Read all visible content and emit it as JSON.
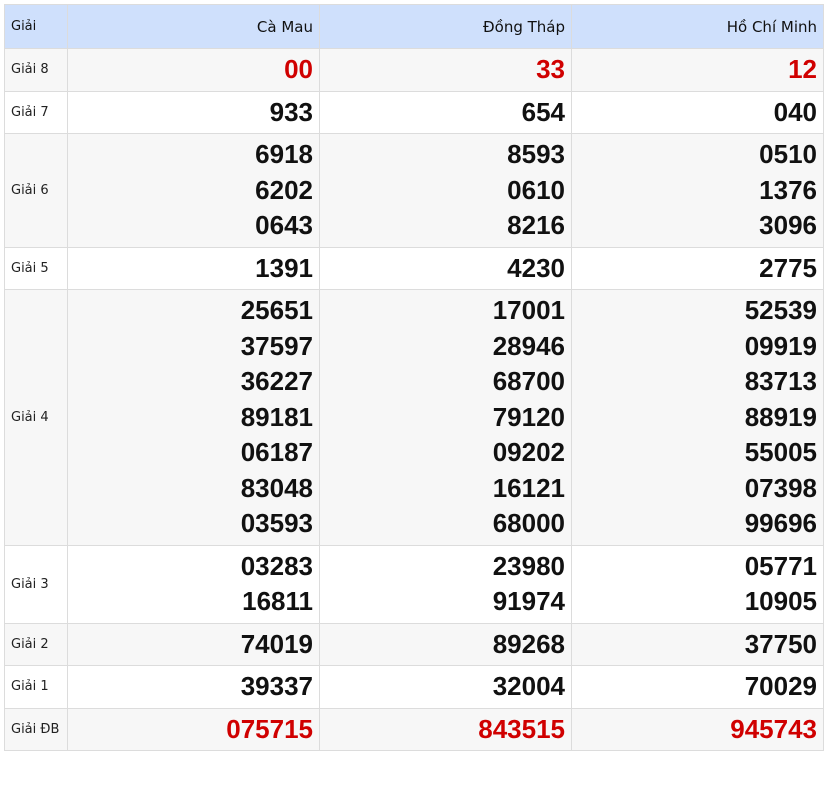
{
  "header": {
    "label": "Giải",
    "provinces": [
      "Cà Mau",
      "Đồng Tháp",
      "Hồ Chí Minh"
    ]
  },
  "prizes": [
    {
      "label": "Giải 8",
      "highlight": true,
      "values": [
        [
          "00"
        ],
        [
          "33"
        ],
        [
          "12"
        ]
      ]
    },
    {
      "label": "Giải 7",
      "highlight": false,
      "values": [
        [
          "933"
        ],
        [
          "654"
        ],
        [
          "040"
        ]
      ]
    },
    {
      "label": "Giải 6",
      "highlight": false,
      "values": [
        [
          "6918",
          "6202",
          "0643"
        ],
        [
          "8593",
          "0610",
          "8216"
        ],
        [
          "0510",
          "1376",
          "3096"
        ]
      ]
    },
    {
      "label": "Giải 5",
      "highlight": false,
      "values": [
        [
          "1391"
        ],
        [
          "4230"
        ],
        [
          "2775"
        ]
      ]
    },
    {
      "label": "Giải 4",
      "highlight": false,
      "values": [
        [
          "25651",
          "37597",
          "36227",
          "89181",
          "06187",
          "83048",
          "03593"
        ],
        [
          "17001",
          "28946",
          "68700",
          "79120",
          "09202",
          "16121",
          "68000"
        ],
        [
          "52539",
          "09919",
          "83713",
          "88919",
          "55005",
          "07398",
          "99696"
        ]
      ]
    },
    {
      "label": "Giải 3",
      "highlight": false,
      "values": [
        [
          "03283",
          "16811"
        ],
        [
          "23980",
          "91974"
        ],
        [
          "05771",
          "10905"
        ]
      ]
    },
    {
      "label": "Giải 2",
      "highlight": false,
      "values": [
        [
          "74019"
        ],
        [
          "89268"
        ],
        [
          "37750"
        ]
      ]
    },
    {
      "label": "Giải 1",
      "highlight": false,
      "values": [
        [
          "39337"
        ],
        [
          "32004"
        ],
        [
          "70029"
        ]
      ]
    },
    {
      "label": "Giải ĐB",
      "highlight": true,
      "values": [
        [
          "075715"
        ],
        [
          "843515"
        ],
        [
          "945743"
        ]
      ]
    }
  ],
  "colors": {
    "header_bg": "#cfe0fc",
    "highlight": "#d00000"
  }
}
